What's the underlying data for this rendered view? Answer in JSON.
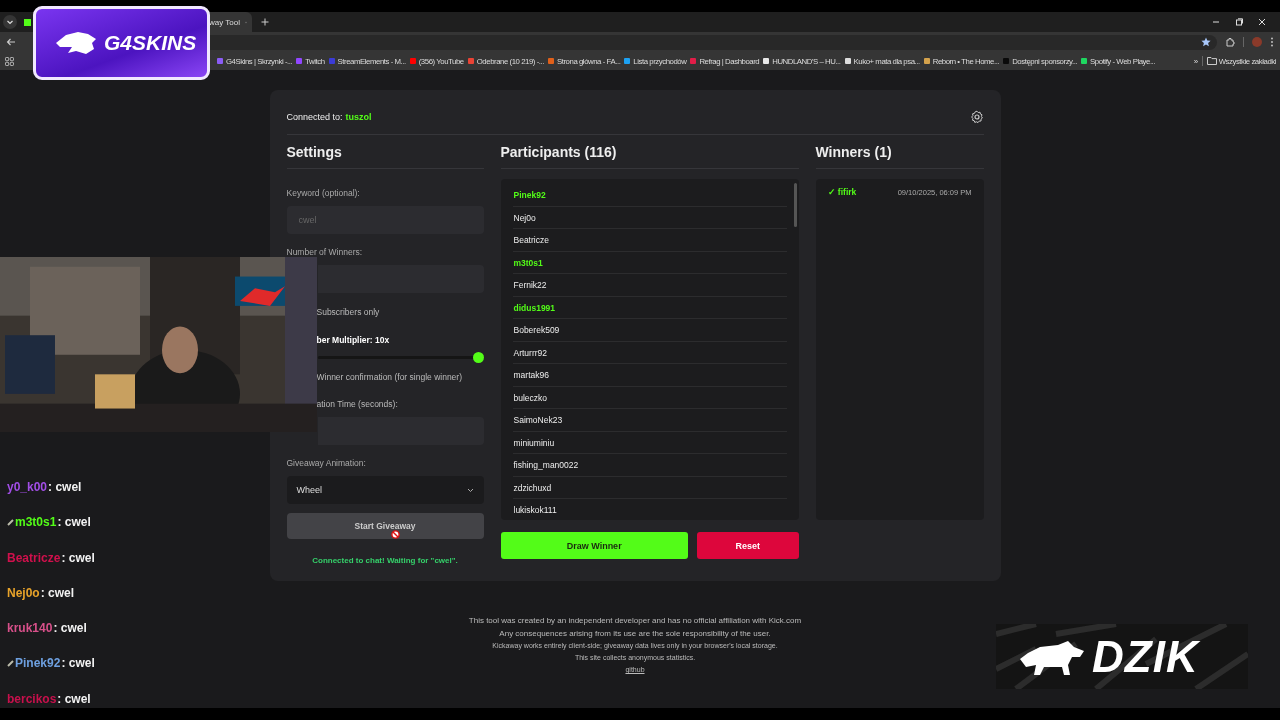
{
  "browser": {
    "tab": {
      "title": "way Tool"
    },
    "bookmarks": [
      {
        "label": "G4Skins | Skrzynki -...",
        "color": "#8b5cf6"
      },
      {
        "label": "Twitch",
        "color": "#9146ff"
      },
      {
        "label": "StreamElements - M...",
        "color": "#3b3bd6"
      },
      {
        "label": "(356) YouTube",
        "color": "#ff0000"
      },
      {
        "label": "Odebrane (10 219) -...",
        "color": "#ea4335"
      },
      {
        "label": "Strona główna - FA...",
        "color": "#e0601a"
      },
      {
        "label": "Lista przychodów",
        "color": "#1da1f2"
      },
      {
        "label": "Refrag | Dashboard",
        "color": "#e11d48"
      },
      {
        "label": "HUNDLAND'S – HU...",
        "color": "#e8e8e8"
      },
      {
        "label": "Kuko+ mata dla psa...",
        "color": "#dddddd"
      },
      {
        "label": "Reborn • The Home...",
        "color": "#d4a24c"
      },
      {
        "label": "Dostępni sponsorzy...",
        "color": "#0a0a0a"
      },
      {
        "label": "Spotify - Web Playe...",
        "color": "#1ed760"
      }
    ],
    "more": "»",
    "all_bookmarks": "Wszystkie zakładki"
  },
  "overlay_logo": {
    "text": "G4SKINS"
  },
  "connection": {
    "label": "Connected to:",
    "channel": "tuszol"
  },
  "settings": {
    "title": "Settings",
    "keyword": {
      "label": "Keyword (optional):",
      "placeholder": "cwel"
    },
    "winners_count": {
      "label": "Number of Winners:"
    },
    "subscribers_only": {
      "label": "Subscribers only"
    },
    "multiplier": {
      "label": "ber Multiplier: 10x",
      "level": 1
    },
    "confirmation": {
      "label": "Winner confirmation (for single winner)"
    },
    "duration": {
      "label": "ation Time (seconds):"
    },
    "animation": {
      "label": "Giveaway Animation:",
      "value": "Wheel"
    },
    "start_button": "Start Giveaway",
    "status": "Connected to chat! Waiting for \"cwel\"."
  },
  "participants": {
    "title": "Participants (116)",
    "items": [
      {
        "name": "Pinek92",
        "highlighted": true
      },
      {
        "name": "Nej0o",
        "highlighted": false
      },
      {
        "name": "Beatricze",
        "highlighted": false
      },
      {
        "name": "m3t0s1",
        "highlighted": true
      },
      {
        "name": "Fernik22",
        "highlighted": false
      },
      {
        "name": "didus1991",
        "highlighted": true
      },
      {
        "name": "Boberek509",
        "highlighted": false
      },
      {
        "name": "Arturrr92",
        "highlighted": false
      },
      {
        "name": "martak96",
        "highlighted": false
      },
      {
        "name": "buleczko",
        "highlighted": false
      },
      {
        "name": "SaimoNek23",
        "highlighted": false
      },
      {
        "name": "miniuminiu",
        "highlighted": false
      },
      {
        "name": "fishing_man0022",
        "highlighted": false
      },
      {
        "name": "zdzichuxd",
        "highlighted": false
      },
      {
        "name": "lukiskok111",
        "highlighted": false
      }
    ],
    "draw_button": "Draw Winner",
    "reset_button": "Reset"
  },
  "winners": {
    "title": "Winners (1)",
    "items": [
      {
        "mark": "✓",
        "name": "fifirk",
        "time": "09/10/2025, 06:09 PM"
      }
    ]
  },
  "footer": {
    "lines": [
      {
        "text": "This tool was created by an independent developer and has no official affiliation with Kick.com",
        "kind": "main"
      },
      {
        "text": "Any consequences arising from its use are the sole responsibility of the user.",
        "kind": "main"
      },
      {
        "text": "Kickaway works entirely client-side; giveaway data lives only in your browser's local storage.",
        "kind": "note"
      },
      {
        "text": "This site collects anonymous statistics.",
        "kind": "note"
      }
    ],
    "link": "github"
  },
  "chat": [
    {
      "user": "y0_k00",
      "color": "#a24ee6",
      "badge": false,
      "message": ": cwel"
    },
    {
      "user": "m3t0s1",
      "color": "#53fc18",
      "badge": true,
      "message": ": cwel"
    },
    {
      "user": "Beatricze",
      "color": "#d0104c",
      "badge": false,
      "message": ": cwel"
    },
    {
      "user": "Nej0o",
      "color": "#e8a32a",
      "badge": false,
      "message": ": cwel"
    },
    {
      "user": "kruk140",
      "color": "#d8508a",
      "badge": false,
      "message": ": cwel"
    },
    {
      "user": "Pinek92",
      "color": "#6ea0e0",
      "badge": true,
      "message": ": cwel"
    },
    {
      "user": "bercikos",
      "color": "#c8104c",
      "badge": false,
      "message": ": cwel"
    }
  ],
  "sponsor_logo": {
    "text": "DZIK"
  }
}
